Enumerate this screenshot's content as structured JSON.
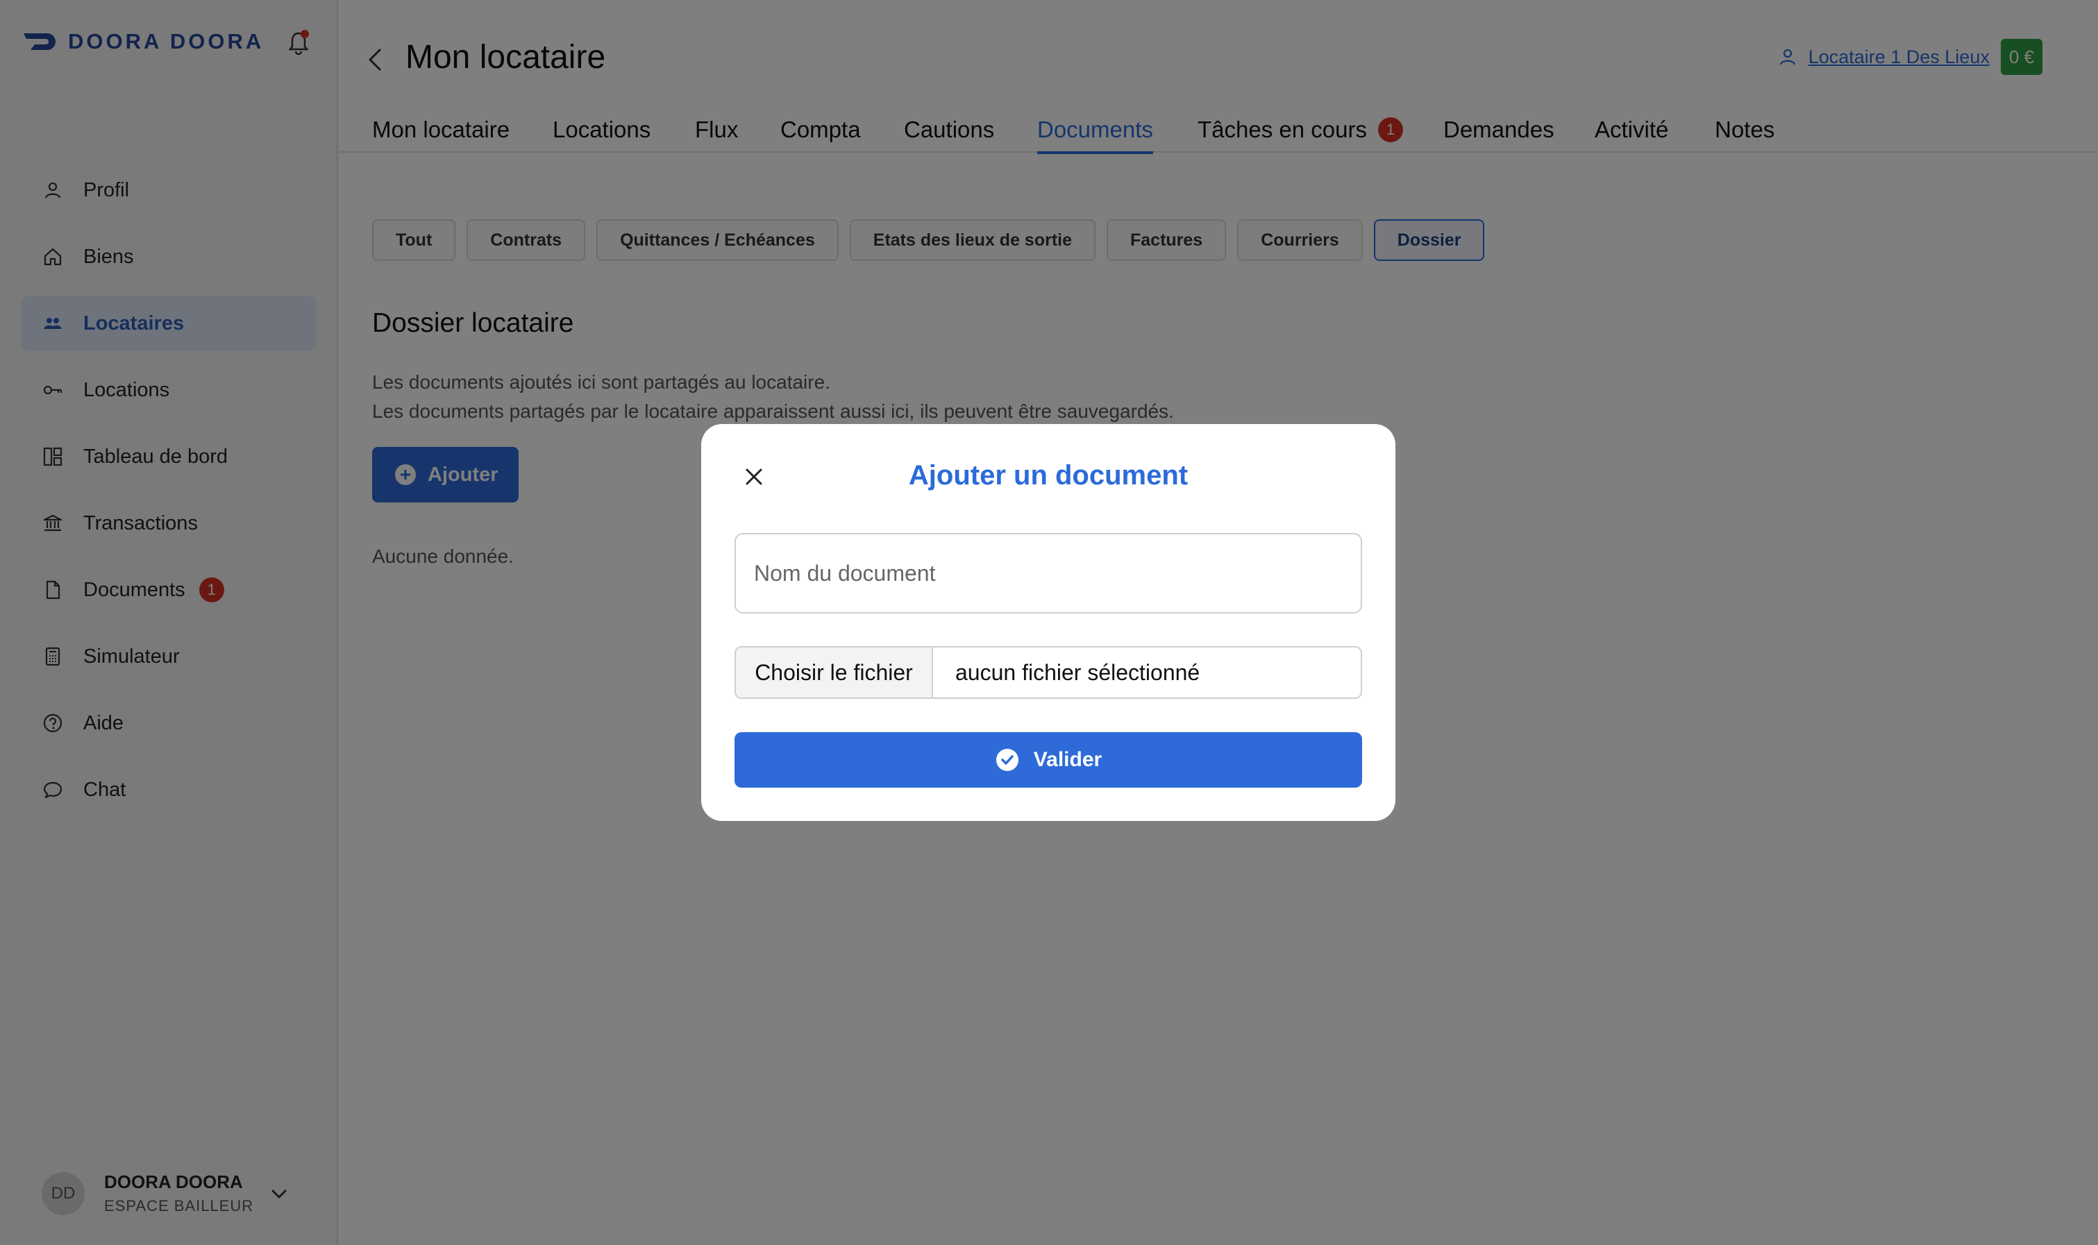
{
  "brand": {
    "name": "DOORA DOORA",
    "color": "#27479c"
  },
  "sidebar": {
    "items": [
      {
        "label": "Profil",
        "icon": "user-icon"
      },
      {
        "label": "Biens",
        "icon": "home-icon"
      },
      {
        "label": "Locataires",
        "icon": "users-icon",
        "active": true
      },
      {
        "label": "Locations",
        "icon": "key-icon"
      },
      {
        "label": "Tableau de bord",
        "icon": "dashboard-icon"
      },
      {
        "label": "Transactions",
        "icon": "bank-icon"
      },
      {
        "label": "Documents",
        "icon": "document-icon",
        "badge": "1"
      },
      {
        "label": "Simulateur",
        "icon": "calculator-icon"
      },
      {
        "label": "Aide",
        "icon": "help-icon"
      },
      {
        "label": "Chat",
        "icon": "chat-icon"
      }
    ],
    "user": {
      "initials": "DD",
      "name": "DOORA DOORA",
      "role": "ESPACE BAILLEUR"
    }
  },
  "header": {
    "title": "Mon locataire",
    "tenant_link": "Locataire 1 Des Lieux",
    "balance": "0 €",
    "balance_color": "#2f9e44"
  },
  "tabs": [
    {
      "label": "Mon locataire"
    },
    {
      "label": "Locations"
    },
    {
      "label": "Flux"
    },
    {
      "label": "Compta"
    },
    {
      "label": "Cautions"
    },
    {
      "label": "Documents",
      "active": true
    },
    {
      "label": "Tâches en cours",
      "badge": "1"
    },
    {
      "label": "Demandes"
    },
    {
      "label": "Activité"
    },
    {
      "label": "Notes"
    }
  ],
  "filters": [
    {
      "label": "Tout"
    },
    {
      "label": "Contrats"
    },
    {
      "label": "Quittances / Echéances"
    },
    {
      "label": "Etats des lieux de sortie"
    },
    {
      "label": "Factures"
    },
    {
      "label": "Courriers"
    },
    {
      "label": "Dossier",
      "active": true
    }
  ],
  "section": {
    "title": "Dossier locataire",
    "desc_line1": "Les documents ajoutés ici sont partagés au locataire.",
    "desc_line2": "Les documents partagés par le locataire apparaissent aussi ici, ils peuvent être sauvegardés.",
    "add_label": "Ajouter",
    "empty": "Aucune donnée."
  },
  "modal": {
    "title": "Ajouter un document",
    "name_placeholder": "Nom du document",
    "name_value": "",
    "file_button": "Choisir le fichier",
    "file_status": "aucun fichier sélectionné",
    "submit_label": "Valider"
  },
  "colors": {
    "accent": "#2b6bd9",
    "badge": "#d93025"
  }
}
